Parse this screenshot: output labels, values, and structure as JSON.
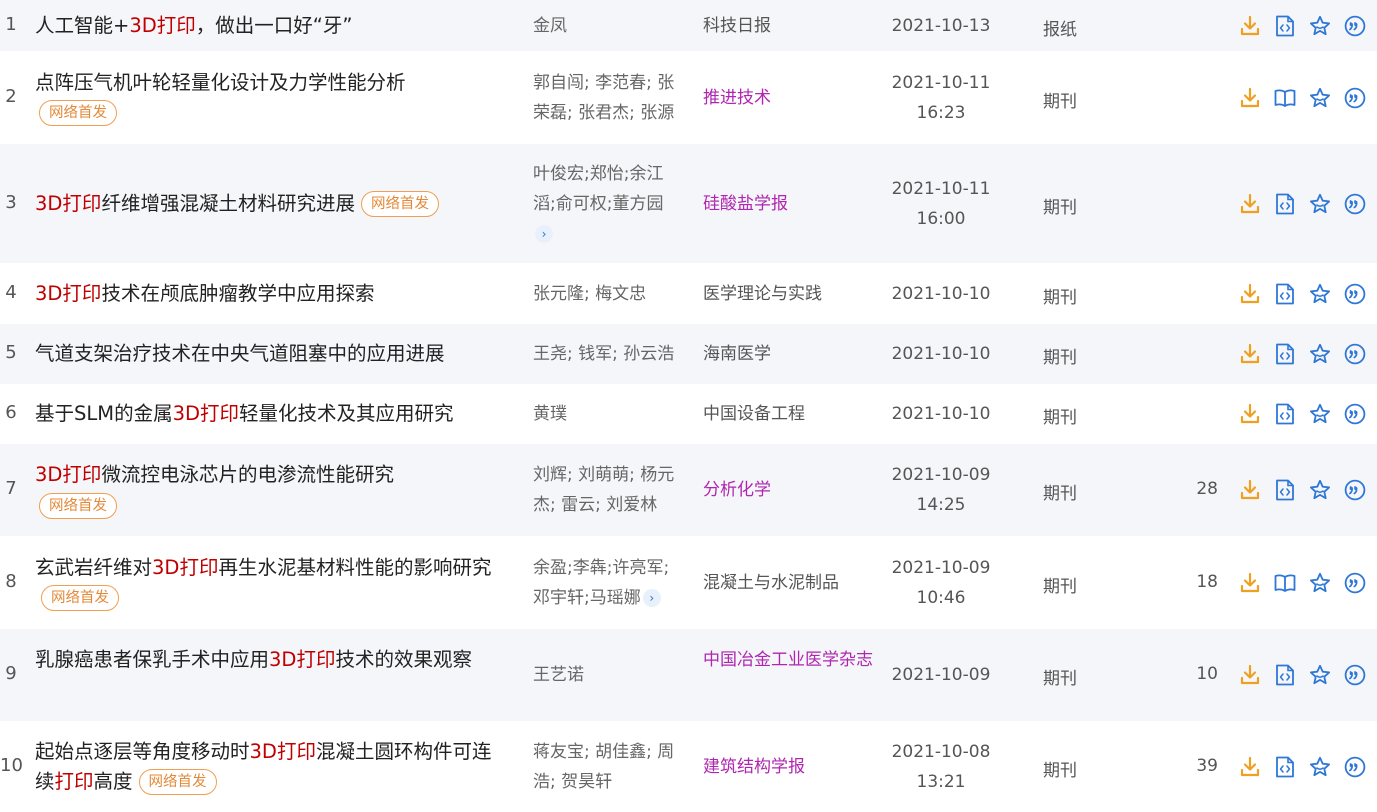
{
  "rows": [
    {
      "num": "1",
      "title": [
        {
          "t": "人工智能+"
        },
        {
          "t": "3D打印",
          "hl": true
        },
        {
          "t": "，做出一口好“牙”"
        }
      ],
      "badge": "",
      "authors": "金凤",
      "more": false,
      "source": "科技日报",
      "source_link": false,
      "date": "2021-10-13",
      "time": "",
      "type": "报纸",
      "cites": "",
      "preview": "html"
    },
    {
      "num": "2",
      "title": [
        {
          "t": "点阵压气机叶轮轻量化设计及力学性能分析"
        }
      ],
      "badge": "网络首发",
      "authors": "郭自闯; 李范春; 张荣磊; 张君杰; 张源",
      "more": false,
      "source": "推进技术",
      "source_link": true,
      "date": "2021-10-11",
      "time": "16:23",
      "type": "期刊",
      "cites": "",
      "preview": "book"
    },
    {
      "num": "3",
      "title": [
        {
          "t": "3D打印",
          "hl": true
        },
        {
          "t": "纤维增强混凝土材料研究进展"
        }
      ],
      "badge": "网络首发",
      "authors": "叶俊宏;郑怡;余江滔;俞可权;董方园",
      "more": true,
      "source": "硅酸盐学报",
      "source_link": true,
      "date": "2021-10-11",
      "time": "16:00",
      "type": "期刊",
      "cites": "",
      "preview": "html"
    },
    {
      "num": "4",
      "title": [
        {
          "t": "3D打印",
          "hl": true
        },
        {
          "t": "技术在颅底肿瘤教学中应用探索"
        }
      ],
      "badge": "",
      "authors": "张元隆; 梅文忠",
      "more": false,
      "source": "医学理论与实践",
      "source_link": false,
      "date": "2021-10-10",
      "time": "",
      "type": "期刊",
      "cites": "",
      "preview": "html"
    },
    {
      "num": "5",
      "title": [
        {
          "t": "气道支架治疗技术在中央气道阻塞中的应用进展"
        }
      ],
      "badge": "",
      "authors": "王尧; 钱军; 孙云浩",
      "more": false,
      "source": "海南医学",
      "source_link": false,
      "date": "2021-10-10",
      "time": "",
      "type": "期刊",
      "cites": "",
      "preview": "html"
    },
    {
      "num": "6",
      "title": [
        {
          "t": "基于SLM的金属"
        },
        {
          "t": "3D打印",
          "hl": true
        },
        {
          "t": "轻量化技术及其应用研究"
        }
      ],
      "badge": "",
      "authors": "黄璞",
      "more": false,
      "source": "中国设备工程",
      "source_link": false,
      "date": "2021-10-10",
      "time": "",
      "type": "期刊",
      "cites": "",
      "preview": "html"
    },
    {
      "num": "7",
      "title": [
        {
          "t": "3D打印",
          "hl": true
        },
        {
          "t": "微流控电泳芯片的电渗流性能研究"
        }
      ],
      "badge": "网络首发",
      "authors": "刘辉; 刘萌萌; 杨元杰; 雷云; 刘爱林",
      "more": false,
      "source": "分析化学",
      "source_link": true,
      "date": "2021-10-09",
      "time": "14:25",
      "type": "期刊",
      "cites": "28",
      "preview": "html"
    },
    {
      "num": "8",
      "title": [
        {
          "t": "玄武岩纤维对"
        },
        {
          "t": "3D打印",
          "hl": true
        },
        {
          "t": "再生水泥基材料性能的影响研究"
        }
      ],
      "badge": "网络首发",
      "authors": "余盈;李犇;许亮军;邓宇轩;马瑶娜",
      "more": true,
      "source": "混凝土与水泥制品",
      "source_link": false,
      "date": "2021-10-09",
      "time": "10:46",
      "type": "期刊",
      "cites": "18",
      "preview": "book"
    },
    {
      "num": "9",
      "title": [
        {
          "t": "乳腺癌患者保乳手术中应用"
        },
        {
          "t": "3D打印",
          "hl": true
        },
        {
          "t": "技术的效果观察"
        }
      ],
      "badge": "",
      "authors": "王艺诺",
      "more": false,
      "source": "中国冶金工业医学杂志",
      "source_link": true,
      "date": "2021-10-09",
      "time": "",
      "type": "期刊",
      "cites": "10",
      "preview": "html"
    },
    {
      "num": "10",
      "title": [
        {
          "t": "起始点逐层等角度移动时"
        },
        {
          "t": "3D打印",
          "hl": true
        },
        {
          "t": "混凝土圆环构件可连续"
        },
        {
          "t": "打印",
          "hl": true
        },
        {
          "t": "高度"
        }
      ],
      "badge": "网络首发",
      "authors": "蒋友宝; 胡佳鑫; 周浩; 贺昊轩",
      "more": false,
      "source": "建筑结构学报",
      "source_link": true,
      "date": "2021-10-08",
      "time": "13:21",
      "type": "期刊",
      "cites": "39",
      "preview": "html"
    }
  ],
  "colors": {
    "highlight": "#c00000",
    "badge": "#e38a3a",
    "link": "#b026b0",
    "download": "#f0a020",
    "icon": "#2f77d6"
  },
  "icons": [
    "download-icon",
    "html-read-icon",
    "book-read-icon",
    "favorite-icon",
    "cite-icon"
  ]
}
